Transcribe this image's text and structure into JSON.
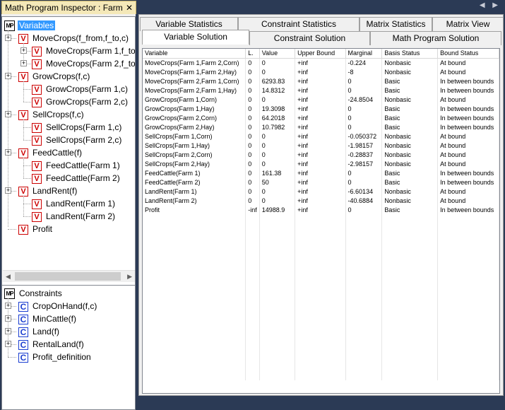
{
  "window": {
    "title": "Math Program Inspector : Farm",
    "close_glyph": "✕",
    "nav_left": "◀",
    "nav_right": "▶"
  },
  "variables_tree": {
    "root": "Variables",
    "nodes": [
      {
        "label": "MoveCrops(f_from,f_to,c)",
        "children": [
          "MoveCrops(Farm 1,f_to",
          "MoveCrops(Farm 2,f_to"
        ]
      },
      {
        "label": "GrowCrops(f,c)",
        "children": [
          "GrowCrops(Farm 1,c)",
          "GrowCrops(Farm 2,c)"
        ]
      },
      {
        "label": "SellCrops(f,c)",
        "children": [
          "SellCrops(Farm 1,c)",
          "SellCrops(Farm 2,c)"
        ]
      },
      {
        "label": "FeedCattle(f)",
        "children": [
          "FeedCattle(Farm 1)",
          "FeedCattle(Farm 2)"
        ]
      },
      {
        "label": "LandRent(f)",
        "children": [
          "LandRent(Farm 1)",
          "LandRent(Farm 2)"
        ]
      },
      {
        "label": "Profit",
        "children": []
      }
    ]
  },
  "constraints_tree": {
    "root": "Constraints",
    "nodes": [
      "CropOnHand(f,c)",
      "MinCattle(f)",
      "Land(f)",
      "RentalLand(f)",
      "Profit_definition"
    ]
  },
  "icons": {
    "variable": "V",
    "constraint": "C",
    "math_program": "MP"
  },
  "tabs_row1": [
    "Variable Statistics",
    "Constraint Statistics",
    "Matrix Statistics",
    "Matrix View"
  ],
  "tabs_row2": [
    "Variable Solution",
    "Constraint Solution",
    "Math Program Solution"
  ],
  "active_tab": "Variable Solution",
  "grid": {
    "columns": [
      "Variable",
      "L.",
      "Value",
      "Upper Bound",
      "Marginal",
      "Basis Status",
      "Bound Status"
    ],
    "rows": [
      [
        "MoveCrops(Farm 1,Farm 2,Corn)",
        "0",
        "0",
        "+inf",
        "-0.224",
        "Nonbasic",
        "At bound"
      ],
      [
        "MoveCrops(Farm 1,Farm 2,Hay)",
        "0",
        "0",
        "+inf",
        "-8",
        "Nonbasic",
        "At bound"
      ],
      [
        "MoveCrops(Farm 2,Farm 1,Corn)",
        "0",
        "6293.83",
        "+inf",
        "0",
        "Basic",
        "In between bounds"
      ],
      [
        "MoveCrops(Farm 2,Farm 1,Hay)",
        "0",
        "14.8312",
        "+inf",
        "0",
        "Basic",
        "In between bounds"
      ],
      [
        "GrowCrops(Farm 1,Corn)",
        "0",
        "0",
        "+inf",
        "-24.8504",
        "Nonbasic",
        "At bound"
      ],
      [
        "GrowCrops(Farm 1,Hay)",
        "0",
        "19.3098",
        "+inf",
        "0",
        "Basic",
        "In between bounds"
      ],
      [
        "GrowCrops(Farm 2,Corn)",
        "0",
        "64.2018",
        "+inf",
        "0",
        "Basic",
        "In between bounds"
      ],
      [
        "GrowCrops(Farm 2,Hay)",
        "0",
        "10.7982",
        "+inf",
        "0",
        "Basic",
        "In between bounds"
      ],
      [
        "SellCrops(Farm 1,Corn)",
        "0",
        "0",
        "+inf",
        "-0.050372",
        "Nonbasic",
        "At bound"
      ],
      [
        "SellCrops(Farm 1,Hay)",
        "0",
        "0",
        "+inf",
        "-1.98157",
        "Nonbasic",
        "At bound"
      ],
      [
        "SellCrops(Farm 2,Corn)",
        "0",
        "0",
        "+inf",
        "-0.28837",
        "Nonbasic",
        "At bound"
      ],
      [
        "SellCrops(Farm 2,Hay)",
        "0",
        "0",
        "+inf",
        "-2.98157",
        "Nonbasic",
        "At bound"
      ],
      [
        "FeedCattle(Farm 1)",
        "0",
        "161.38",
        "+inf",
        "0",
        "Basic",
        "In between bounds"
      ],
      [
        "FeedCattle(Farm 2)",
        "0",
        "50",
        "+inf",
        "0",
        "Basic",
        "In between bounds"
      ],
      [
        "LandRent(Farm 1)",
        "0",
        "0",
        "+inf",
        "-6.60134",
        "Nonbasic",
        "At bound"
      ],
      [
        "LandRent(Farm 2)",
        "0",
        "0",
        "+inf",
        "-40.6884",
        "Nonbasic",
        "At bound"
      ],
      [
        "Profit",
        "-inf",
        "14988.9",
        "+inf",
        "0",
        "Basic",
        "In between bounds"
      ]
    ]
  },
  "colors": {
    "selection": "#3399ff",
    "variable_icon": "#cc0000",
    "constraint_icon": "#1c3fd1",
    "doc_tab": "#f4e8b8",
    "frame": "#2b3a55"
  }
}
